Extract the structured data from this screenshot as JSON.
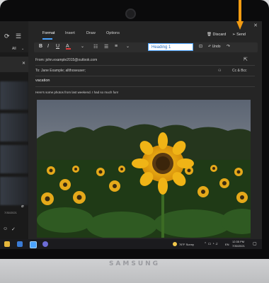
{
  "format_tabs": [
    "Format",
    "Insert",
    "Draw",
    "Options"
  ],
  "top_actions": {
    "discard": "Discard",
    "send": "Send"
  },
  "style_box": "Heading 1",
  "undo_label": "Undo",
  "from": "From: john.example2015@outlook.com",
  "to": "To: Jane Example; allthoseuser;",
  "cc_bcc": "Cc & Bcc",
  "subject": "vacation",
  "body": "Here's some photos from last weekend. I had so much fun!",
  "left_pane": {
    "filter": "All",
    "date": "7/30/2021"
  },
  "taskbar": {
    "weather": "76°F Sunny",
    "lang": "EN",
    "time": "12:35 PM",
    "date": "7/30/2021"
  },
  "brand": "SAMSUNG",
  "colors": {
    "accent": "#4aa3ff",
    "annotation_arrow": "#f39c12",
    "font_color_bar": "#e03c3c"
  }
}
